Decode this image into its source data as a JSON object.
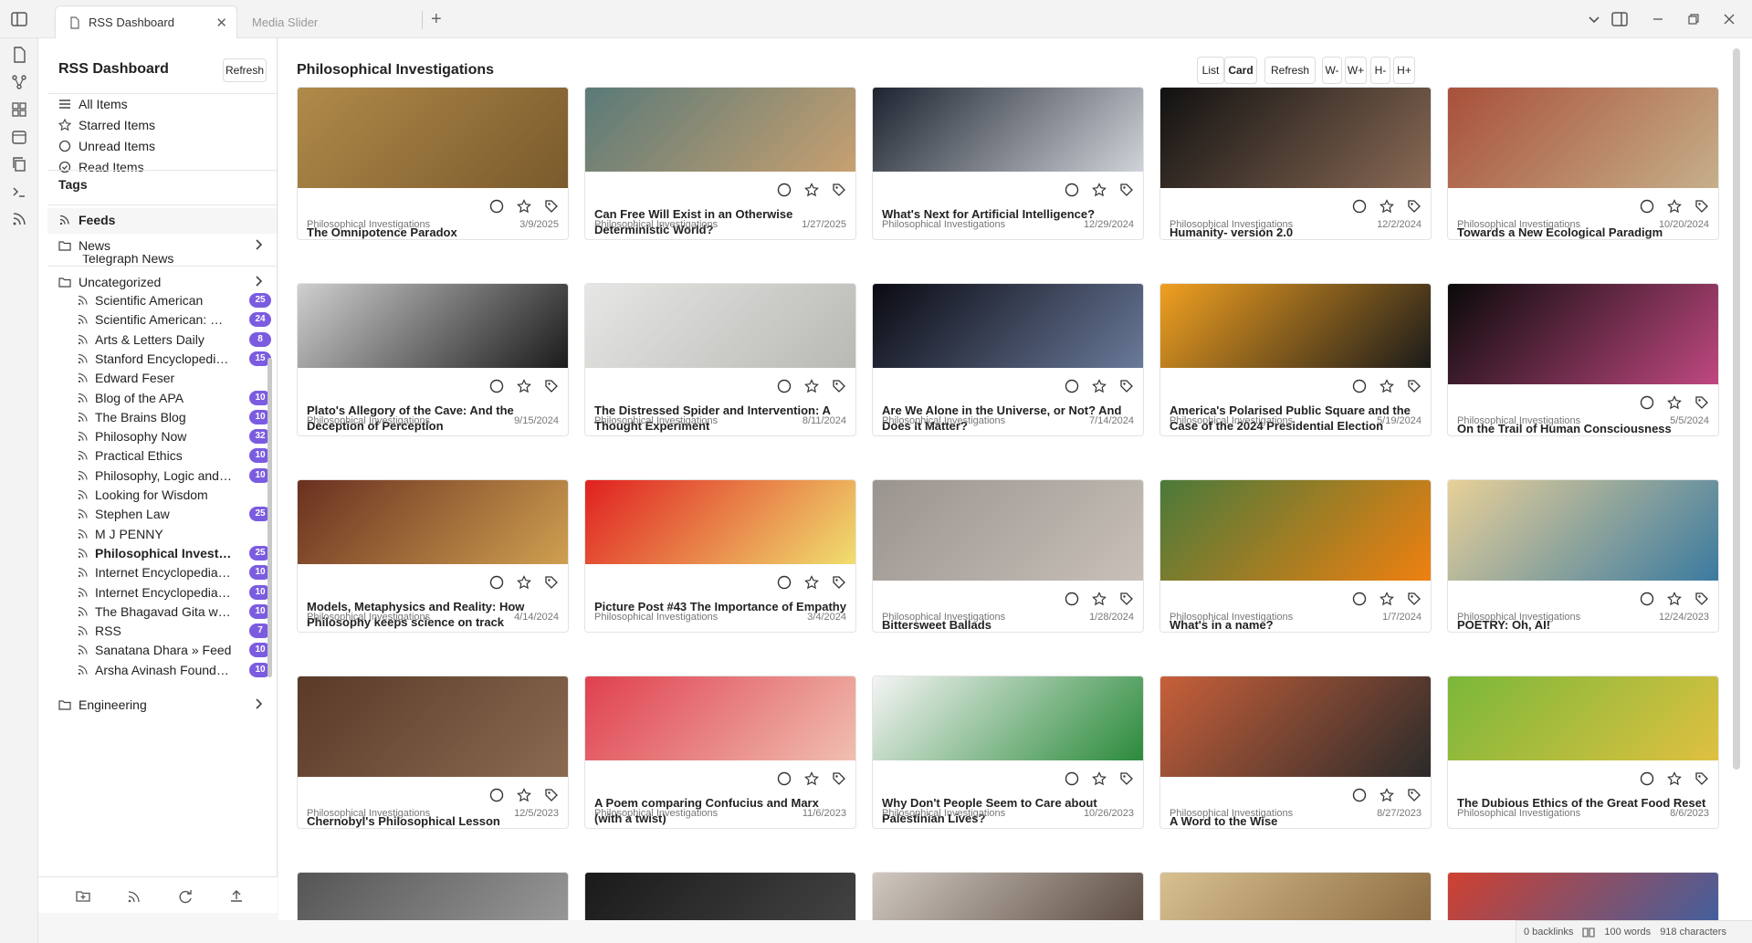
{
  "tabs": [
    {
      "label": "RSS Dashboard",
      "active": true
    },
    {
      "label": "Media Slider",
      "active": false
    }
  ],
  "sidebar": {
    "title": "RSS Dashboard",
    "refresh_label": "Refresh",
    "filters": [
      {
        "label": "All Items",
        "icon": "list-icon"
      },
      {
        "label": "Starred Items",
        "icon": "star-icon"
      },
      {
        "label": "Unread Items",
        "icon": "circle-icon"
      },
      {
        "label": "Read Items",
        "icon": "check-circle-icon"
      }
    ],
    "tags_label": "Tags",
    "feeds_label": "Feeds",
    "folders": {
      "news": "News",
      "news_child": "Telegraph News",
      "uncategorized": "Uncategorized",
      "engineering": "Engineering"
    },
    "feeds": [
      {
        "name": "Scientific American",
        "count": "25"
      },
      {
        "name": "Scientific American: Mind & Brain",
        "count": "24"
      },
      {
        "name": "Arts & Letters Daily",
        "count": "8"
      },
      {
        "name": "Stanford Encyclopedia of Philosophy",
        "count": "15"
      },
      {
        "name": "Edward Feser",
        "count": ""
      },
      {
        "name": "Blog of the APA",
        "count": "10"
      },
      {
        "name": "The Brains Blog",
        "count": "10"
      },
      {
        "name": "Philosophy Now",
        "count": "32"
      },
      {
        "name": "Practical Ethics",
        "count": "10"
      },
      {
        "name": "Philosophy, Logic and Science",
        "count": "10"
      },
      {
        "name": "Looking for Wisdom",
        "count": ""
      },
      {
        "name": "Stephen Law",
        "count": "25"
      },
      {
        "name": "M J PENNY",
        "count": ""
      },
      {
        "name": "Philosophical Investigations",
        "count": "25",
        "bold": true
      },
      {
        "name": "Internet Encyclopedia of Philosophy",
        "count": "10"
      },
      {
        "name": "Internet Encyclopedia of Philosophy",
        "count": "10"
      },
      {
        "name": "The Bhagavad Gita with commentary",
        "count": "10"
      },
      {
        "name": "RSS",
        "count": "7"
      },
      {
        "name": "Sanatana Dhara » Feed",
        "count": "10"
      },
      {
        "name": "Arsha Avinash Foundation",
        "count": "10"
      }
    ]
  },
  "main": {
    "title": "Philosophical Investigations",
    "buttons": {
      "list": "List",
      "card": "Card",
      "refresh": "Refresh",
      "w_minus": "W-",
      "w_plus": "W+",
      "h_minus": "H-",
      "h_plus": "H+"
    },
    "cards": [
      {
        "title": "The Omnipotence Paradox",
        "feed": "Philosophical Investigations",
        "date": "3/9/2025",
        "colors": [
          "#b08a4a",
          "#7a5a2c"
        ]
      },
      {
        "title": "Can Free Will Exist in an Otherwise Deterministic World?",
        "feed": "Philosophical Investigations",
        "date": "1/27/2025",
        "colors": [
          "#5a7a78",
          "#c8a070"
        ]
      },
      {
        "title": "What's Next for Artificial Intelligence?",
        "feed": "Philosophical Investigations",
        "date": "12/29/2024",
        "colors": [
          "#1e2430",
          "#d0d4da"
        ]
      },
      {
        "title": "Humanity- version 2.0",
        "feed": "Philosophical Investigations",
        "date": "12/2/2024",
        "colors": [
          "#111111",
          "#8a6a55"
        ]
      },
      {
        "title": "Towards a New Ecological Paradigm",
        "feed": "Philosophical Investigations",
        "date": "10/20/2024",
        "colors": [
          "#a8503a",
          "#c6b08a"
        ]
      },
      {
        "title": "Plato's Allegory of the Cave: And the Deception of Perception",
        "feed": "Philosophical Investigations",
        "date": "9/15/2024",
        "colors": [
          "#cfcfcf",
          "#1a1a1a"
        ]
      },
      {
        "title": "The Distressed Spider and Intervention: A Thought Experiment",
        "feed": "Philosophical Investigations",
        "date": "8/11/2024",
        "colors": [
          "#e6e6e4",
          "#b8b8b4"
        ]
      },
      {
        "title": "Are We Alone in the Universe, or Not? And Does It Matter?",
        "feed": "Philosophical Investigations",
        "date": "7/14/2024",
        "colors": [
          "#0a0a12",
          "#6a7a9a"
        ]
      },
      {
        "title": "America's Polarised Public Square and the Case of the 2024 Presidential Election",
        "feed": "Philosophical Investigations",
        "date": "5/19/2024",
        "colors": [
          "#f0a020",
          "#1a1a1a"
        ]
      },
      {
        "title": "On the Trail of Human Consciousness",
        "feed": "Philosophical Investigations",
        "date": "5/5/2024",
        "colors": [
          "#0a0a0a",
          "#c04880"
        ]
      },
      {
        "title": "Models, Metaphysics and Reality: How Philosophy keeps science on track",
        "feed": "Philosophical Investigations",
        "date": "4/14/2024",
        "colors": [
          "#6a3020",
          "#d0a050"
        ]
      },
      {
        "title": "Picture Post #43 The Importance of Empathy",
        "feed": "Philosophical Investigations",
        "date": "3/4/2024",
        "colors": [
          "#e02020",
          "#f0e070"
        ]
      },
      {
        "title": "Bittersweet Ballads",
        "feed": "Philosophical Investigations",
        "date": "1/28/2024",
        "colors": [
          "#9a9490",
          "#c8c0b8"
        ]
      },
      {
        "title": "What's in a name?",
        "feed": "Philosophical Investigations",
        "date": "1/7/2024",
        "colors": [
          "#4a7a3a",
          "#f08010"
        ]
      },
      {
        "title": "POETRY: Oh, AI!",
        "feed": "Philosophical Investigations",
        "date": "12/24/2023",
        "colors": [
          "#e8d098",
          "#3a7aa0"
        ]
      },
      {
        "title": "Chernobyl's Philosophical Lesson",
        "feed": "Philosophical Investigations",
        "date": "12/5/2023",
        "colors": [
          "#5a3a28",
          "#8a6a50"
        ]
      },
      {
        "title": "A Poem comparing Confucius and Marx (with a twist)",
        "feed": "Philosophical Investigations",
        "date": "11/6/2023",
        "colors": [
          "#e04050",
          "#f0c0b0"
        ]
      },
      {
        "title": "Why Don't People Seem to Care about Palestinian Lives?",
        "feed": "Philosophical Investigations",
        "date": "10/26/2023",
        "colors": [
          "#f4f4f4",
          "#2a8a3a"
        ]
      },
      {
        "title": "A Word to the Wise",
        "feed": "Philosophical Investigations",
        "date": "8/27/2023",
        "colors": [
          "#c8603a",
          "#2a2a2a"
        ]
      },
      {
        "title": "The Dubious Ethics of the Great Food Reset",
        "feed": "Philosophical Investigations",
        "date": "8/6/2023",
        "colors": [
          "#7ab83a",
          "#e0c040"
        ]
      }
    ],
    "partial_cards": [
      {
        "colors": [
          "#555555",
          "#999999"
        ]
      },
      {
        "colors": [
          "#1a1a1a",
          "#444444"
        ]
      },
      {
        "colors": [
          "#d0c8c0",
          "#5a4a40"
        ]
      },
      {
        "colors": [
          "#d8c090",
          "#8a6a40"
        ]
      },
      {
        "colors": [
          "#d04030",
          "#4060a0"
        ]
      }
    ]
  },
  "status": {
    "backlinks": "0 backlinks",
    "words": "100 words",
    "chars": "918 characters"
  }
}
